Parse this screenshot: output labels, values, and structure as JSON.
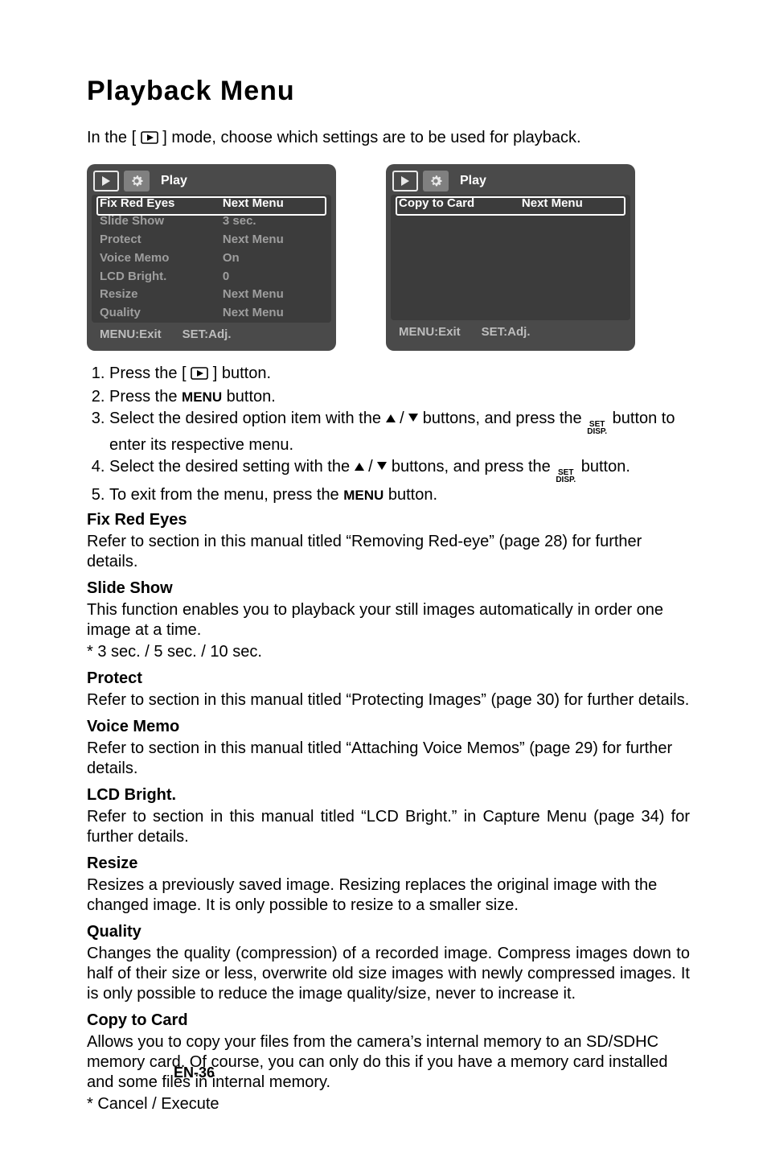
{
  "title": "Playback Menu",
  "intro_a": "In the [",
  "intro_b": "] mode, choose which settings are to be used for playback.",
  "panel1": {
    "title": "Play",
    "rows": [
      {
        "label": "Fix Red Eyes",
        "val": "Next Menu",
        "sel": true
      },
      {
        "label": "Slide Show",
        "val": "3 sec."
      },
      {
        "label": "Protect",
        "val": "Next Menu"
      },
      {
        "label": "Voice Memo",
        "val": "On"
      },
      {
        "label": "LCD Bright.",
        "val": "0"
      },
      {
        "label": "Resize",
        "val": "Next Menu"
      },
      {
        "label": "Quality",
        "val": "Next Menu"
      }
    ],
    "footer_left": "MENU:Exit",
    "footer_right": "SET:Adj."
  },
  "panel2": {
    "title": "Play",
    "rows": [
      {
        "label": "Copy to Card",
        "val": "Next Menu",
        "sel": true
      }
    ],
    "footer_left": "MENU:Exit",
    "footer_right": "SET:Adj."
  },
  "steps": {
    "s1a": "Press the [",
    "s1b": "] button.",
    "s2a": "Press the ",
    "s2_menu": "MENU",
    "s2b": " button.",
    "s3a": "Select the desired option item with the ",
    "s3b": " buttons, and press the ",
    "s3c": " button to enter its respective menu.",
    "s4a": "Select the desired setting with the ",
    "s4b": " buttons, and press the ",
    "s4c": " button.",
    "s5a": "To exit from the menu, press the ",
    "s5b": " button."
  },
  "set_disp": {
    "top": "SET",
    "bot": "DISP."
  },
  "sections": {
    "fix_head": "Fix Red Eyes",
    "fix_body": "Refer to section in this manual titled “Removing Red-eye” (page 28) for further details.",
    "slide_head": "Slide Show",
    "slide_body1": "This function enables you to playback your still images automatically in order one image at a time.",
    "slide_body2": "*  3 sec.  /  5 sec.  /  10 sec.",
    "protect_head": "Protect",
    "protect_body": "Refer to section in this manual titled “Protecting Images” (page 30) for further details.",
    "voice_head": "Voice Memo",
    "voice_body": "Refer to section in this manual titled “Attaching Voice Memos” (page 29) for further details.",
    "lcd_head": "LCD Bright.",
    "lcd_body": "Refer to section in this manual titled “LCD Bright.” in Capture Menu (page 34) for further details.",
    "resize_head": "Resize",
    "resize_body": "Resizes a previously saved image. Resizing replaces the original image with the changed image. It is only possible to resize to a smaller size.",
    "quality_head": "Quality",
    "quality_body": "Changes the quality (compression) of a recorded image. Compress images down to half of their size or less, overwrite old size images with newly compressed images. It is only possible to reduce the image quality/size, never to increase it.",
    "copy_head": "Copy to Card",
    "copy_body1": "Allows you to copy your files from the camera’s internal memory to an SD/SDHC memory card. Of course, you can only do this if you have a memory card installed and some files in internal memory.",
    "copy_body2": "* Cancel / Execute"
  },
  "page_footer": "EN-36"
}
